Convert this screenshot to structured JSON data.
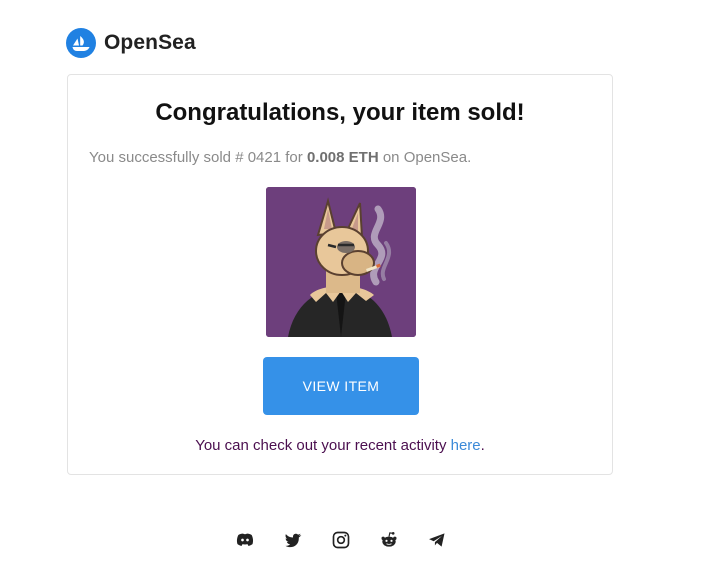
{
  "brand": {
    "name": "OpenSea",
    "accent": "#2081e2"
  },
  "email": {
    "headline": "Congratulations, your item sold!",
    "sold_prefix": "You successfully sold",
    "item_name": "# 0421",
    "for_word": "for",
    "price": "0.008 ETH",
    "on_text": "on OpenSea.",
    "item_image_icon": "nft-llama-image",
    "button_label": "VIEW ITEM",
    "button_color": "#3591e8",
    "activity_text": "You can check out your recent activity",
    "activity_link": "here",
    "activity_end": "."
  },
  "footer": {
    "socials": [
      "discord-icon",
      "twitter-icon",
      "instagram-icon",
      "reddit-icon",
      "telegram-icon"
    ]
  }
}
